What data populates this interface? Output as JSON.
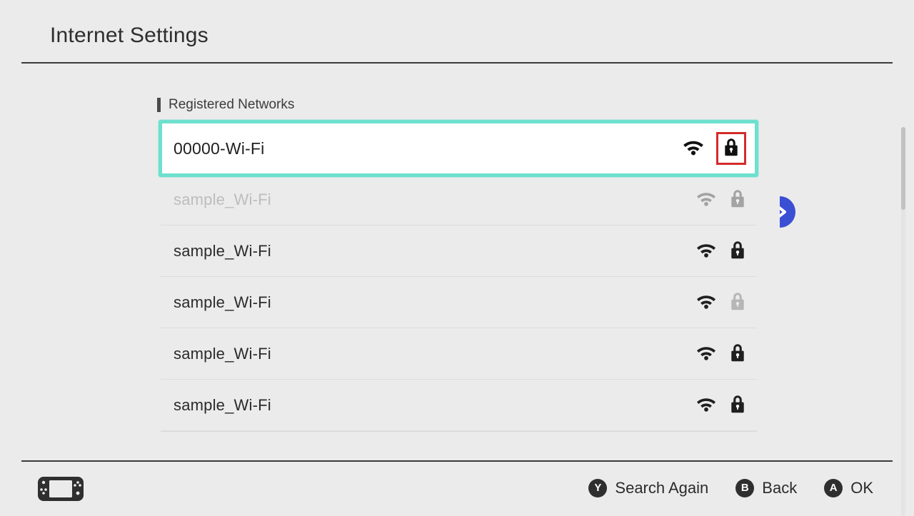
{
  "header": {
    "title": "Internet Settings"
  },
  "content": {
    "section_heading": "Registered Networks",
    "selected_network": {
      "name": "00000-Wi-Fi",
      "wifi_icon": "wifi-icon",
      "lock_icon": "lock-icon",
      "locked": true,
      "highlighted": true,
      "highlight_color": "#d42b2b",
      "selection_color": "#6ee0cd"
    },
    "networks": [
      {
        "name": "sample_Wi-Fi",
        "wifi_icon": "wifi-icon",
        "lock_icon": "lock-icon",
        "state": "dimmed"
      },
      {
        "name": "sample_Wi-Fi",
        "wifi_icon": "wifi-icon",
        "lock_icon": "lock-icon",
        "state": "normal"
      },
      {
        "name": "sample_Wi-Fi",
        "wifi_icon": "wifi-icon",
        "lock_icon": "lock-icon-grey",
        "state": "normal"
      },
      {
        "name": "sample_Wi-Fi",
        "wifi_icon": "wifi-icon",
        "lock_icon": "lock-icon",
        "state": "normal"
      },
      {
        "name": "sample_Wi-Fi",
        "wifi_icon": "wifi-icon",
        "lock_icon": "lock-icon",
        "state": "normal"
      }
    ],
    "cursor_icon": "pointer-cursor",
    "cursor_color": "#3b4fd4"
  },
  "scrollbar": {
    "thumb_position_percent": 0,
    "thumb_size_percent": 21
  },
  "footer": {
    "console_icon": "switch-console-icon",
    "buttons": [
      {
        "glyph": "Y",
        "label": "Search Again"
      },
      {
        "glyph": "B",
        "label": "Back"
      },
      {
        "glyph": "A",
        "label": "OK"
      }
    ]
  }
}
